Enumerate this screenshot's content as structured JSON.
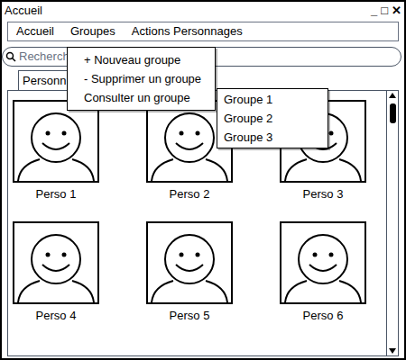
{
  "window": {
    "title": "Accueil",
    "controls": [
      "_",
      "□",
      "✕"
    ]
  },
  "menu": [
    {
      "label": "Accueil",
      "expanded": false
    },
    {
      "label": "Groupes",
      "expanded": true
    },
    {
      "label": "Actions Personnages",
      "expanded": false
    }
  ],
  "groups_menu": [
    {
      "label": "+ Nouveau groupe",
      "expanded": false,
      "submenu": []
    },
    {
      "label": "- Supprimer un groupe",
      "expanded": false,
      "submenu": []
    },
    {
      "label": "Consulter un groupe",
      "expanded": true,
      "submenu": [
        "Groupe 1",
        "Groupe 2",
        "Groupe 3"
      ]
    }
  ],
  "search": {
    "placeholder": "Recherch"
  },
  "tabs": [
    {
      "label": "Personn",
      "selected": true
    }
  ],
  "characters": [
    "Perso 1",
    "Perso 2",
    "Perso 3",
    "Perso 4",
    "Perso 5",
    "Perso 6"
  ]
}
